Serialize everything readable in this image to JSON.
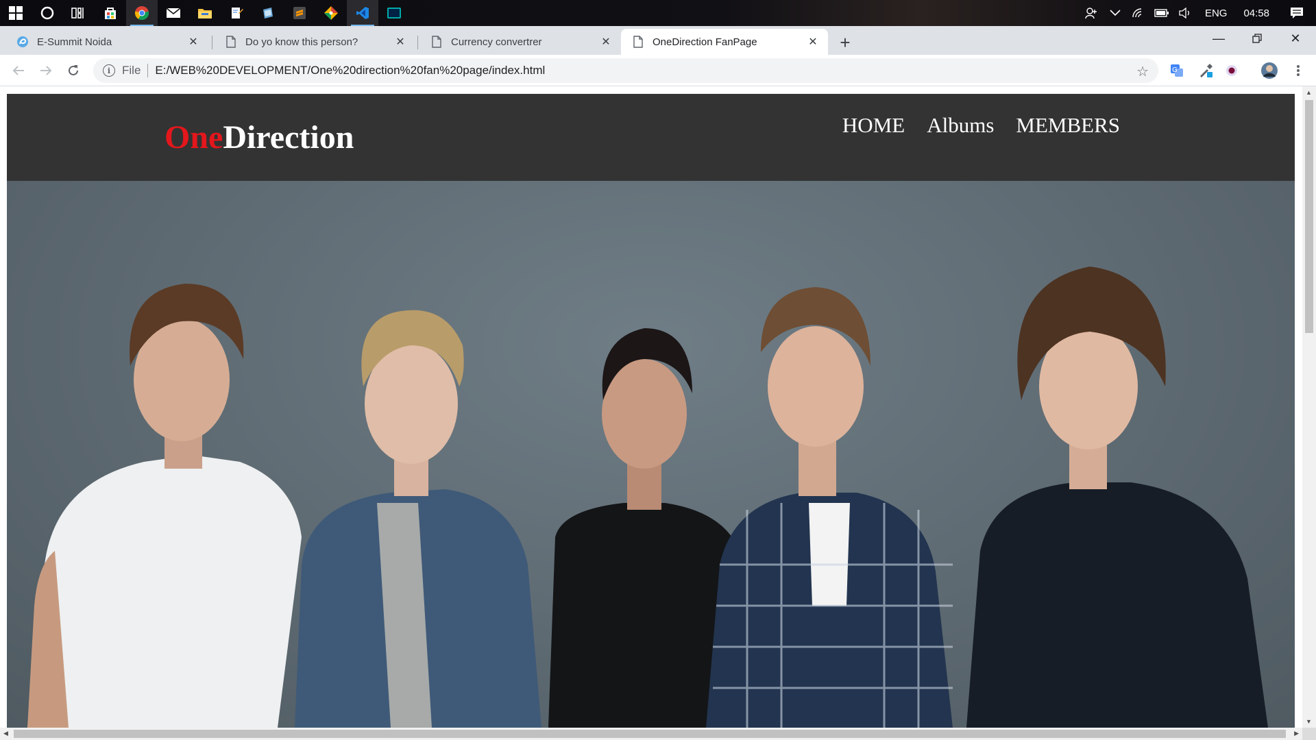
{
  "taskbar": {
    "apps": [
      {
        "name": "windows-start"
      },
      {
        "name": "cortana"
      },
      {
        "name": "task-view"
      },
      {
        "name": "store"
      },
      {
        "name": "chrome",
        "active": true
      },
      {
        "name": "mail"
      },
      {
        "name": "file-explorer"
      },
      {
        "name": "notepad"
      },
      {
        "name": "app-blue"
      },
      {
        "name": "sublime-text"
      },
      {
        "name": "git"
      },
      {
        "name": "vscode"
      },
      {
        "name": "terminal"
      }
    ],
    "language": "ENG",
    "time": "04:58"
  },
  "browser": {
    "tabs": [
      {
        "title": "E-Summit Noida",
        "active": false
      },
      {
        "title": "Do yo know this person?",
        "active": false
      },
      {
        "title": "Currency convertrer",
        "active": false
      },
      {
        "title": "OneDirection FanPage",
        "active": true
      }
    ],
    "address": {
      "scheme": "File",
      "url": "E:/WEB%20DEVELOPMENT/One%20direction%20fan%20page/index.html"
    }
  },
  "page": {
    "logo": {
      "accent": "One",
      "rest": "Direction"
    },
    "nav": [
      "HOME",
      "Albums",
      "MEMBERS"
    ],
    "hero_image_alt": "One Direction band photo"
  },
  "colors": {
    "header_bg": "#333333",
    "logo_accent": "#e3171c",
    "hero_bg": "#5e6a72"
  }
}
